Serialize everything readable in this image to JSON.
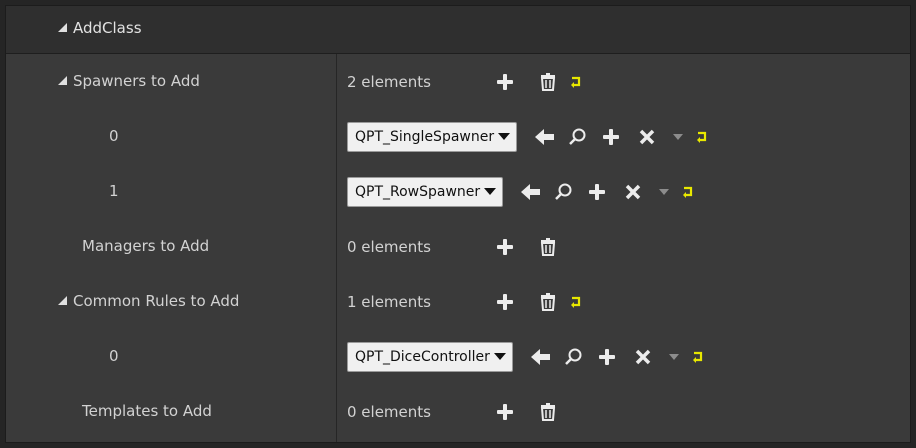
{
  "category": {
    "label": "AddClass",
    "icon": "triangle-down-icon"
  },
  "rows": [
    {
      "name": "Spawners to Add",
      "value": "2 elements"
    },
    {
      "name": "0",
      "value": "QPT_SingleSpawner"
    },
    {
      "name": "1",
      "value": "QPT_RowSpawner"
    },
    {
      "name": "Managers to Add",
      "value": "0 elements"
    },
    {
      "name": "Common Rules to Add",
      "value": "1 elements"
    },
    {
      "name": "0",
      "value": "QPT_DiceController"
    },
    {
      "name": "Templates to Add",
      "value": "0 elements"
    }
  ],
  "colors": {
    "reset_arrow": "#e8e800",
    "panel_bg": "#3a3a3a",
    "header_bg": "#2f2f2f"
  }
}
